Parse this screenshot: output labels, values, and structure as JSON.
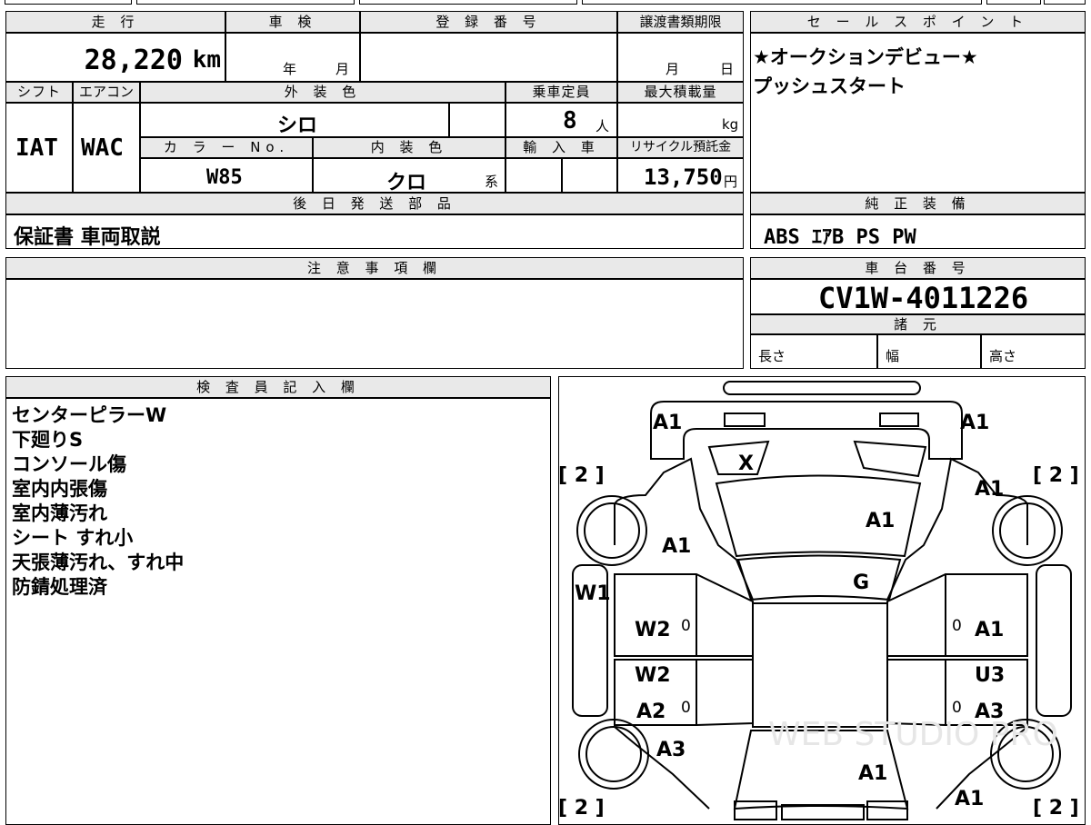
{
  "top_table": {
    "headers": {
      "mileage": "走 行",
      "inspection": "車 検",
      "registration": "登 録 番 号",
      "transfer_deadline": "譲渡書類期限",
      "shift": "シフト",
      "aircon": "エアコン",
      "exterior_color": "外 装 色",
      "capacity": "乗車定員",
      "max_load": "最大積載量",
      "color_no": "カ ラ ー No.",
      "interior_color": "内 装 色",
      "import": "輸 入 車",
      "recycle_fee": "リサイクル預託金",
      "later_parts": "後 日 発 送 部 品"
    },
    "values": {
      "mileage_num": "28,220",
      "mileage_unit": "km",
      "inspection_year": "年",
      "inspection_month": "月",
      "transfer_month": "月",
      "transfer_day": "日",
      "shift": "IAT",
      "aircon": "WAC",
      "exterior_color": "シロ",
      "capacity_num": "8",
      "capacity_unit": "人",
      "max_load_unit": "kg",
      "color_no": "W85",
      "interior_color": "クロ",
      "interior_suffix": "系",
      "recycle_num": "13,750",
      "recycle_unit": "円",
      "later_parts": "保証書 車両取説"
    }
  },
  "sales_points": {
    "header": "セ ー ル ス ポ イ ン ト",
    "lines": [
      "★オークションデビュー★",
      "プッシュスタート"
    ]
  },
  "genuine_equipment": {
    "header": "純 正 装 備",
    "value": "ABS ｴｱB PS PW"
  },
  "notes": {
    "header": "注 意 事 項 欄"
  },
  "chassis": {
    "header": "車 台 番 号",
    "value": "CV1W-4011226"
  },
  "specs": {
    "header": "諸 元",
    "length": "長さ",
    "width": "幅",
    "height": "高さ"
  },
  "inspector": {
    "header": "検 査 員 記 入 欄",
    "lines": [
      "センターピラーW",
      "下廻りS",
      "コンソール傷",
      "室内内張傷",
      "室内薄汚れ",
      "シート すれ小",
      "天張薄汚れ、すれ中",
      "防錆処理済"
    ]
  },
  "diagram": {
    "marks": {
      "front_left": "A1",
      "front_right": "A1",
      "windshield": "X",
      "hood": "A1",
      "left_front_fender": "A1",
      "right_front_fender": "A1",
      "roof": "G",
      "left_pillar": "W1",
      "left_front_door": "W2",
      "left_rear_door": "W2",
      "left_rear_lower": "A2",
      "left_rear_fender": "A3",
      "right_front_door": "A1",
      "right_rear_door": "U3",
      "right_rear_lower": "A3",
      "rear_center": "A1",
      "rear_right": "A1"
    },
    "zeros": [
      "0",
      "0",
      "0",
      "0"
    ],
    "brackets": [
      "[ 2 ]",
      "[ 2 ]",
      "[ 2 ]",
      "[ 2 ]"
    ],
    "watermark": "WEB STUDIO PRO"
  }
}
